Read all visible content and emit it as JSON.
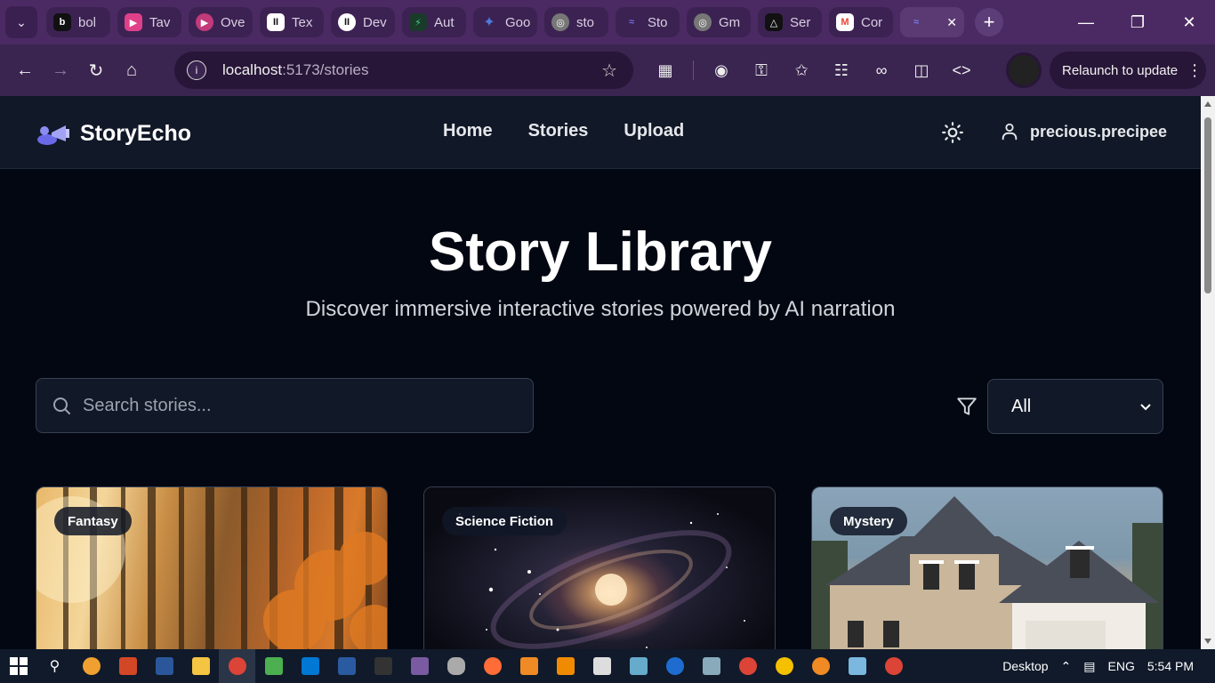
{
  "browser": {
    "tabs": [
      {
        "label": "bol",
        "icon": "b",
        "icon_color": "#111111"
      },
      {
        "label": "Tav",
        "icon": "▶",
        "icon_color": "#e0408a"
      },
      {
        "label": "Ove",
        "icon": "▶",
        "icon_color": "#c23a7a"
      },
      {
        "label": "Tex",
        "icon": "II",
        "icon_color": "#ffffff"
      },
      {
        "label": "Dev",
        "icon": "II",
        "icon_color": "#ffffff"
      },
      {
        "label": "Aut",
        "icon": "⚡",
        "icon_color": "#1a3a2a"
      },
      {
        "label": "Goo",
        "icon": "✦",
        "icon_color": "#4a7bdc"
      },
      {
        "label": "sto",
        "icon": "◎",
        "icon_color": "#888888"
      },
      {
        "label": "Sto",
        "icon": "≈",
        "icon_color": "#5a5ad0"
      },
      {
        "label": "Gm",
        "icon": "◎",
        "icon_color": "#888888"
      },
      {
        "label": "Ser",
        "icon": "△",
        "icon_color": "#222222"
      },
      {
        "label": "Cor",
        "icon": "M",
        "icon_color": "#ea4335"
      }
    ],
    "active_tab_close": "✕",
    "new_tab": "+",
    "url_host": "localhost",
    "url_path": ":5173/stories",
    "relaunch_label": "Relaunch to update"
  },
  "site": {
    "brand": "StoryEcho",
    "nav": [
      "Home",
      "Stories",
      "Upload"
    ],
    "username": "precious.precipee"
  },
  "hero": {
    "title": "Story Library",
    "subtitle": "Discover immersive interactive stories powered by AI narration"
  },
  "search": {
    "placeholder": "Search stories..."
  },
  "filter": {
    "selected": "All"
  },
  "stories": [
    {
      "genre": "Fantasy",
      "image": "autumn forest"
    },
    {
      "genre": "Science Fiction",
      "image": "spiral galaxy"
    },
    {
      "genre": "Mystery",
      "image": "suburban house"
    }
  ],
  "taskbar": {
    "desktop_label": "Desktop",
    "language": "ENG",
    "time": "5:54 PM"
  }
}
